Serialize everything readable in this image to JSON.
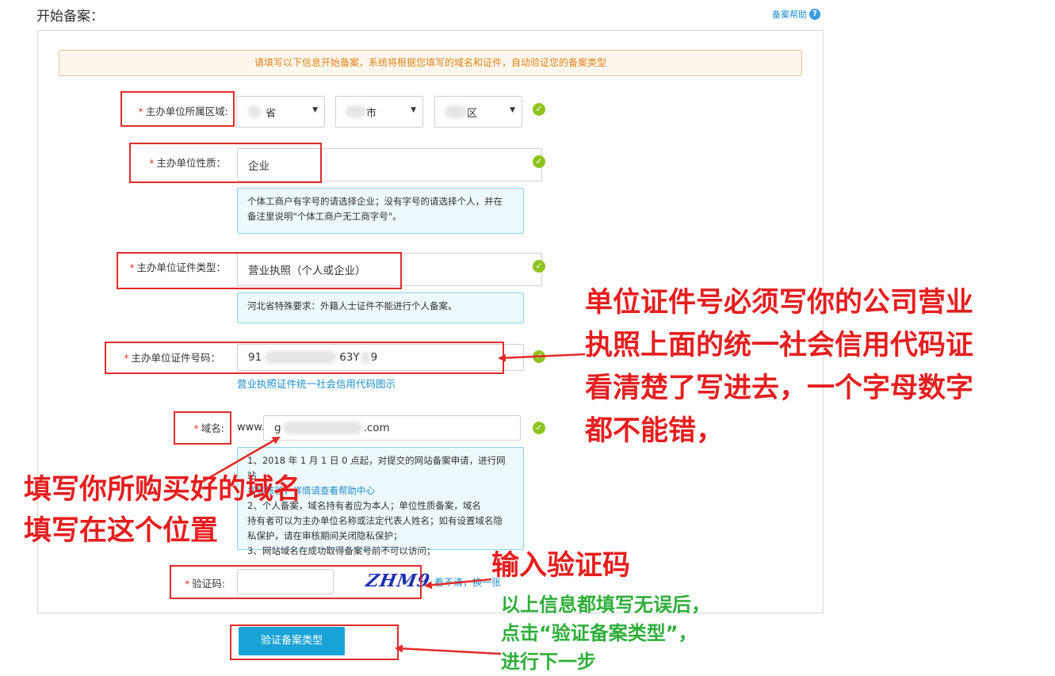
{
  "header": {
    "title": "开始备案：",
    "help": "备案帮助",
    "help_icon": "?"
  },
  "notice": "请填写以下信息开始备案，系统将根据您填写的域名和证件，自动验证您的备案类型",
  "form": {
    "region": {
      "label": "主办单位所属区域:",
      "province": "省",
      "city": "市",
      "district": "区"
    },
    "nature": {
      "label": "主办单位性质：",
      "value": "企业",
      "tip_line1": "个体工商户有字号的请选择企业；没有字号的请选择个人，并在",
      "tip_line2": "备注里说明\"个体工商户无工商字号\"。"
    },
    "cert_type": {
      "label": "主办单位证件类型：",
      "value": "营业执照（个人或企业）",
      "tip": "河北省特殊要求：外籍人士证件不能进行个人备案。"
    },
    "cert_no": {
      "label": "主办单位证件号码：",
      "prefix": "91",
      "middle": "63Y",
      "suffix": "9",
      "help_link": "营业执照证件统一社会信用代码图示"
    },
    "domain": {
      "label": "域名:",
      "www": "www.",
      "prefix": "g",
      "suffix": ".com",
      "tip_lines": [
        "1、2018 年 1 月 1 日 0 点起，对提交的网站备案申请，进行网站",
        "名称核验，详情请查看帮助中心",
        "2、个人备案，域名持有者应为本人；单位性质备案，域名",
        "持有者可以为主办单位名称或法定代表人姓名；如有设置域名隐",
        "私保护，请在审核期间关闭隐私保护；",
        "3、网站域名在成功取得备案号前不可以访问；"
      ]
    },
    "captcha": {
      "label": "验证码:",
      "image_text": "ZHM9",
      "refresh": "看不清，换一张"
    },
    "check_mark": "✓",
    "submit": "验证备案类型"
  },
  "annotations": {
    "cert_lines": [
      "单位证件号必须写你的公司营业",
      "执照上面的统一社会信用代码证",
      "看清楚了写进去，一个字母数字",
      "都不能错，"
    ],
    "domain_lines": [
      "填写你所购买好的域名",
      "填写在这个位置"
    ],
    "captcha_note": "输入验证码",
    "submit_lines": [
      "以上信息都填写无误后，",
      "点击“验证备案类型”，",
      "进行下一步"
    ]
  },
  "colors": {
    "accent": "#1aa3d7",
    "annotation_red": "#e61e1e",
    "annotation_green": "#2fae3b",
    "check_green": "#8fc31f"
  }
}
